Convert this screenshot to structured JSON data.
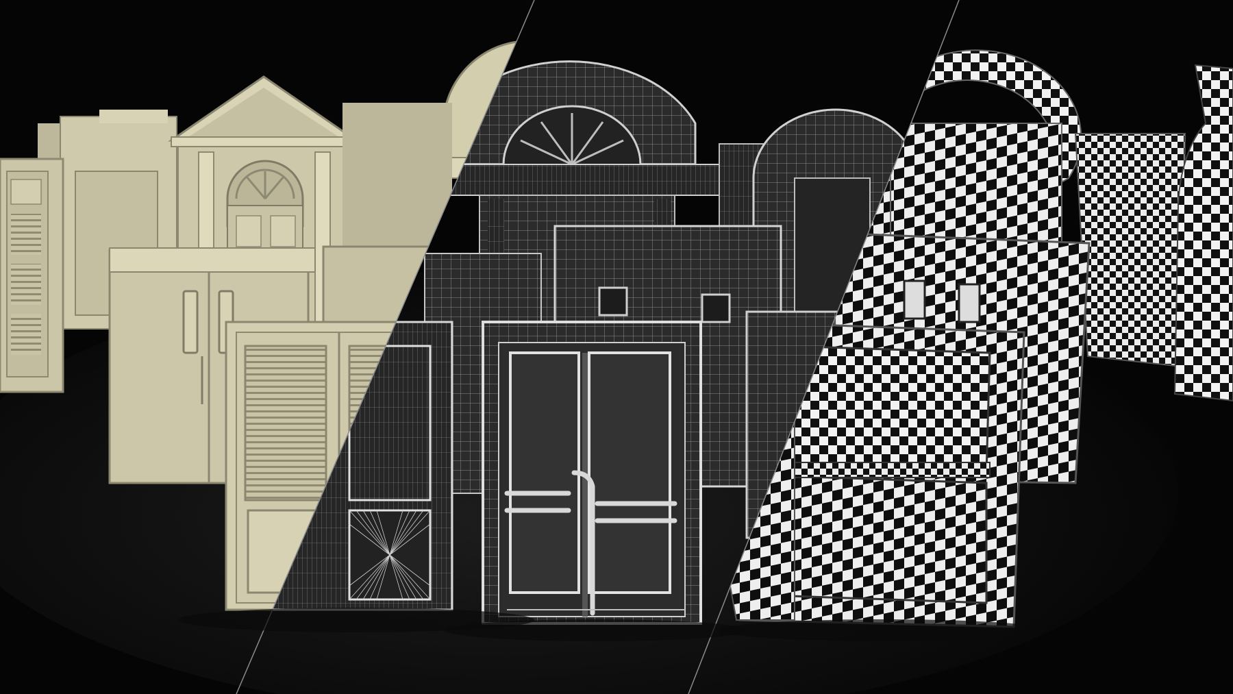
{
  "scene": {
    "panels": [
      {
        "id": "clay",
        "shading": "clay",
        "color": "#d6d1b3",
        "icon": "clay-shading-icon"
      },
      {
        "id": "wireframe",
        "shading": "wireframe",
        "color": "#9a9a9a",
        "icon": "wireframe-icon"
      },
      {
        "id": "checker",
        "shading": "uv-checker",
        "color": "#ffffff",
        "icon": "checker-pattern-icon"
      }
    ],
    "colors": {
      "background": "#050505",
      "floor": "#141414",
      "clay_light": "#dcd7b8",
      "clay_dark": "#8d8a72",
      "wire_fill": "#2a2a2a",
      "wire_line": "#bdbdbd",
      "checker_dark": "#111111",
      "checker_light": "#f2f2f2",
      "divider": "#8a8a8a"
    }
  }
}
